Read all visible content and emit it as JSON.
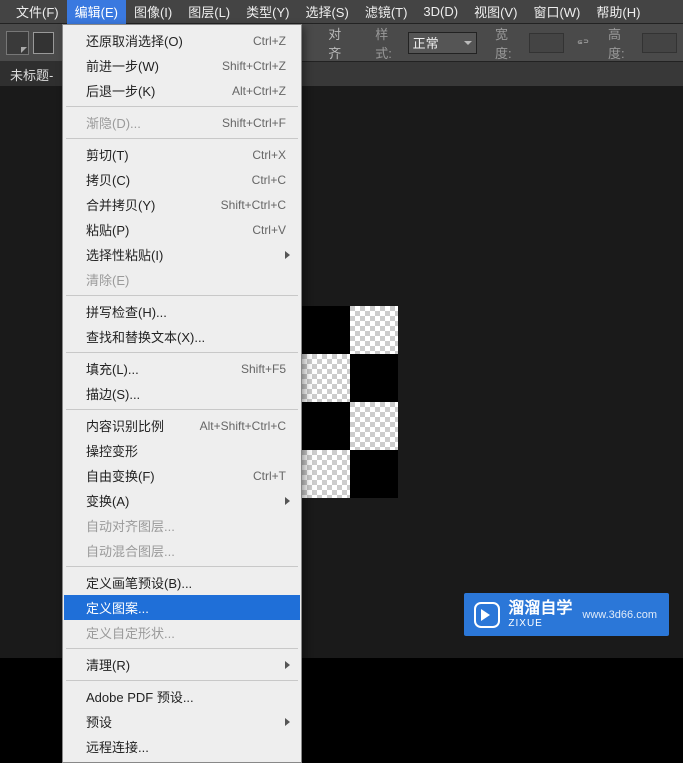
{
  "menubar": {
    "items": [
      {
        "label": "文件(F)"
      },
      {
        "label": "编辑(E)"
      },
      {
        "label": "图像(I)"
      },
      {
        "label": "图层(L)"
      },
      {
        "label": "类型(Y)"
      },
      {
        "label": "选择(S)"
      },
      {
        "label": "滤镜(T)"
      },
      {
        "label": "3D(D)"
      },
      {
        "label": "视图(V)"
      },
      {
        "label": "窗口(W)"
      },
      {
        "label": "帮助(H)"
      }
    ]
  },
  "toolbar": {
    "align_label": "对齐",
    "style_label": "样式:",
    "style_value": "正常",
    "width_label": "宽度:",
    "height_label": "高度:"
  },
  "doc": {
    "tab": "未标题-"
  },
  "edit_menu": [
    {
      "type": "item",
      "label": "还原取消选择(O)",
      "shortcut": "Ctrl+Z"
    },
    {
      "type": "item",
      "label": "前进一步(W)",
      "shortcut": "Shift+Ctrl+Z"
    },
    {
      "type": "item",
      "label": "后退一步(K)",
      "shortcut": "Alt+Ctrl+Z"
    },
    {
      "type": "sep"
    },
    {
      "type": "item",
      "label": "渐隐(D)...",
      "shortcut": "Shift+Ctrl+F",
      "disabled": true
    },
    {
      "type": "sep"
    },
    {
      "type": "item",
      "label": "剪切(T)",
      "shortcut": "Ctrl+X"
    },
    {
      "type": "item",
      "label": "拷贝(C)",
      "shortcut": "Ctrl+C"
    },
    {
      "type": "item",
      "label": "合并拷贝(Y)",
      "shortcut": "Shift+Ctrl+C"
    },
    {
      "type": "item",
      "label": "粘贴(P)",
      "shortcut": "Ctrl+V"
    },
    {
      "type": "item",
      "label": "选择性粘贴(I)",
      "submenu": true
    },
    {
      "type": "item",
      "label": "清除(E)",
      "disabled": true
    },
    {
      "type": "sep"
    },
    {
      "type": "item",
      "label": "拼写检查(H)..."
    },
    {
      "type": "item",
      "label": "查找和替换文本(X)..."
    },
    {
      "type": "sep"
    },
    {
      "type": "item",
      "label": "填充(L)...",
      "shortcut": "Shift+F5"
    },
    {
      "type": "item",
      "label": "描边(S)..."
    },
    {
      "type": "sep"
    },
    {
      "type": "item",
      "label": "内容识别比例",
      "shortcut": "Alt+Shift+Ctrl+C"
    },
    {
      "type": "item",
      "label": "操控变形"
    },
    {
      "type": "item",
      "label": "自由变换(F)",
      "shortcut": "Ctrl+T"
    },
    {
      "type": "item",
      "label": "变换(A)",
      "submenu": true
    },
    {
      "type": "item",
      "label": "自动对齐图层...",
      "disabled": true
    },
    {
      "type": "item",
      "label": "自动混合图层...",
      "disabled": true
    },
    {
      "type": "sep"
    },
    {
      "type": "item",
      "label": "定义画笔预设(B)..."
    },
    {
      "type": "item",
      "label": "定义图案...",
      "hover": true
    },
    {
      "type": "item",
      "label": "定义自定形状...",
      "disabled": true
    },
    {
      "type": "sep"
    },
    {
      "type": "item",
      "label": "清理(R)",
      "submenu": true
    },
    {
      "type": "sep"
    },
    {
      "type": "item",
      "label": "Adobe PDF 预设..."
    },
    {
      "type": "item",
      "label": "预设",
      "submenu": true
    },
    {
      "type": "item",
      "label": "远程连接..."
    }
  ],
  "watermark": {
    "tag": "溜溜自学",
    "sub": "ZIXUE",
    "site": "www.3d66.com"
  }
}
